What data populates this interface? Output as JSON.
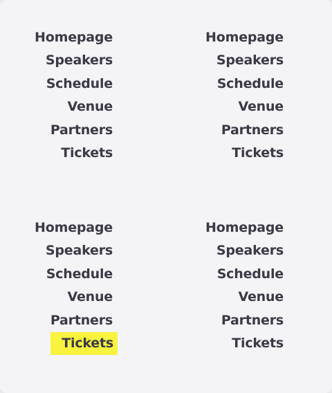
{
  "colors": {
    "background": "#f4f3f6",
    "text": "#3a3a45",
    "highlight": "#f7f33f"
  },
  "menus": [
    {
      "items": [
        {
          "label": "Homepage"
        },
        {
          "label": "Speakers"
        },
        {
          "label": "Schedule"
        },
        {
          "label": "Venue"
        },
        {
          "label": "Partners"
        },
        {
          "label": "Tickets"
        }
      ]
    },
    {
      "items": [
        {
          "label": "Homepage"
        },
        {
          "label": "Speakers"
        },
        {
          "label": "Schedule"
        },
        {
          "label": "Venue"
        },
        {
          "label": "Partners"
        },
        {
          "label": "Tickets"
        }
      ]
    },
    {
      "items": [
        {
          "label": "Homepage"
        },
        {
          "label": "Speakers"
        },
        {
          "label": "Schedule"
        },
        {
          "label": "Venue"
        },
        {
          "label": "Partners"
        },
        {
          "label": "Tickets",
          "highlighted": true
        }
      ]
    },
    {
      "items": [
        {
          "label": "Homepage"
        },
        {
          "label": "Speakers"
        },
        {
          "label": "Schedule"
        },
        {
          "label": "Venue"
        },
        {
          "label": "Partners"
        },
        {
          "label": "Tickets"
        }
      ]
    }
  ]
}
